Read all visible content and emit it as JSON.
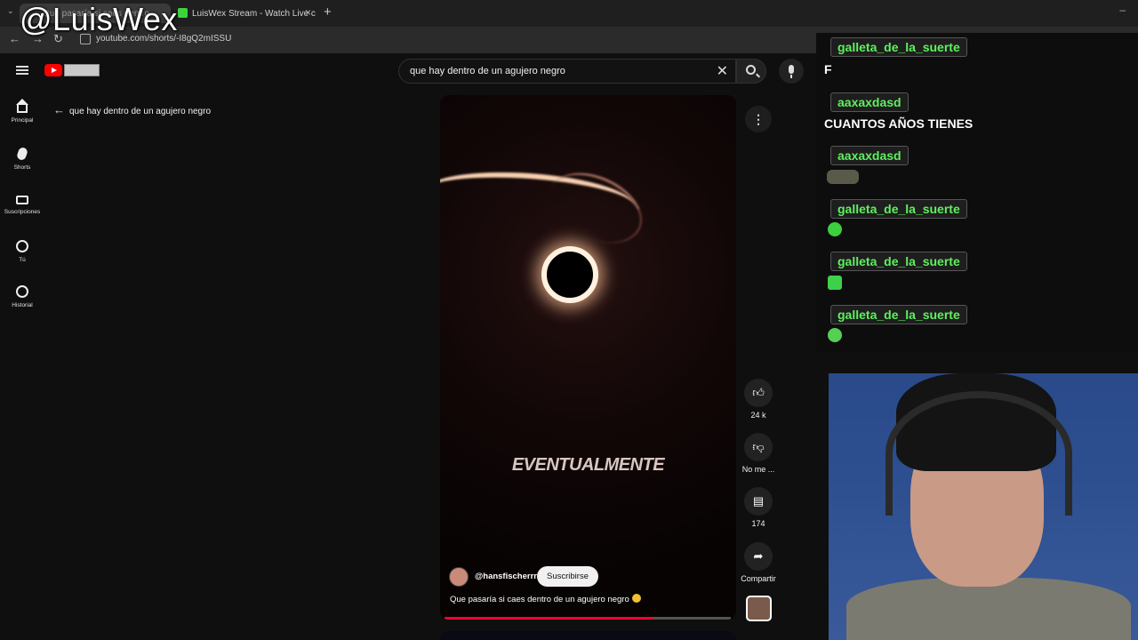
{
  "browser": {
    "tabs": [
      {
        "title": "Que pasaría si caes dentro"
      },
      {
        "title": "LuisWex Stream - Watch Live c"
      }
    ],
    "url": "youtube.com/shorts/-I8gQ2mISSU"
  },
  "watermark": "@LuisWex",
  "header": {
    "search_query": "que hay dentro de un agujero negro"
  },
  "sidebar": {
    "items": [
      {
        "label": "Principal",
        "icon": "home-icon"
      },
      {
        "label": "Shorts",
        "icon": "shorts-icon"
      },
      {
        "label": "Suscripciones",
        "icon": "subscriptions-icon"
      },
      {
        "label": "Tú",
        "icon": "user-icon"
      },
      {
        "label": "Historial",
        "icon": "history-icon"
      }
    ]
  },
  "back_row": {
    "label": "que hay dentro de un agujero negro"
  },
  "video": {
    "overlay_text": "EVENTUALMENTE",
    "channel": "@hansfischerrr",
    "subscribe_label": "Suscribirse",
    "caption": "Que pasaría si caes dentro de un agujero negro",
    "progress": 0.73
  },
  "actions": {
    "like_count": "24 k",
    "dislike_label": "No me ...",
    "comment_count": "174",
    "share_label": "Compartir"
  },
  "chat": {
    "messages": [
      {
        "user": "galleta_de_la_suerte",
        "text": "F"
      },
      {
        "user": "aaxaxdasd",
        "text": "CUANTOS AÑOS TIENES"
      },
      {
        "user": "aaxaxdasd",
        "emote": "cat-emote"
      },
      {
        "user": "galleta_de_la_suerte",
        "emote": "frog-emote"
      },
      {
        "user": "galleta_de_la_suerte",
        "emote": "frog-emote"
      },
      {
        "user": "galleta_de_la_suerte",
        "emote": "frog-emote"
      }
    ],
    "name_color": "#5ff05f"
  }
}
